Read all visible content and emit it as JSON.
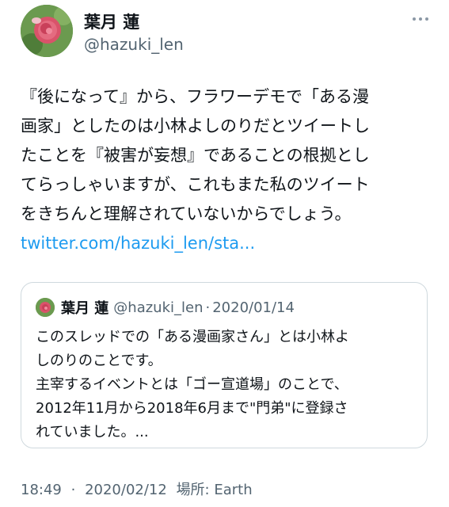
{
  "tweet": {
    "author_name": "葉月 蓮",
    "author_handle": "@hazuki_len",
    "body_lines": [
      "『後になって』から、フラワーデモで「ある漫",
      "画家」としたのは小林よしのりだとツイートし",
      "たことを『被害が妄想』であることの根拠とし",
      "てらっしゃいますが、これもまた私のツイート",
      "をきちんと理解されていないからでしょう。"
    ],
    "link_text": "twitter.com/hazuki_len/sta...",
    "more_icon": "more-dots-icon"
  },
  "quoted": {
    "author_name": "葉月 蓮",
    "author_handle": "@hazuki_len",
    "separator": "·",
    "date": "2020/01/14",
    "body_lines": [
      "このスレッドでの「ある漫画家さん」とは小林よ",
      "しのりのことです。",
      "主宰するイベントとは「ゴー宣道場」のことで、",
      "2012年11月から2018年6月まで\"門弟\"に登録さ",
      "れていました。..."
    ]
  },
  "meta": {
    "time": "18:49",
    "separator": "·",
    "date": "2020/02/12",
    "location_label": "場所: Earth"
  },
  "colors": {
    "link": "#1d9bf0",
    "secondary_text": "#536471",
    "border": "#cfd9de"
  }
}
